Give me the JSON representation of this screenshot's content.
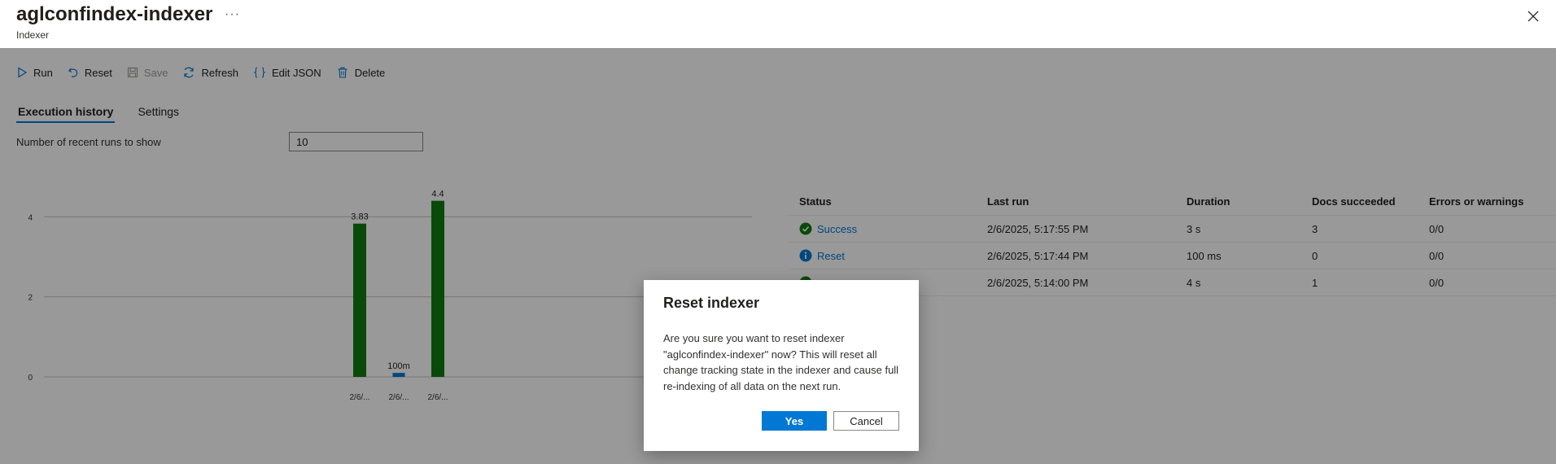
{
  "header": {
    "title": "aglconfindex-indexer",
    "more": "···",
    "subtitle": "Indexer"
  },
  "toolbar": {
    "run": "Run",
    "reset": "Reset",
    "save": "Save",
    "refresh": "Refresh",
    "edit_json": "Edit JSON",
    "delete": "Delete"
  },
  "tabs": {
    "execution_history": "Execution history",
    "settings": "Settings"
  },
  "runs": {
    "label": "Number of recent runs to show",
    "value": "10"
  },
  "chart_data": {
    "type": "bar",
    "categories": [
      "2/6/...",
      "2/6/...",
      "2/6/..."
    ],
    "values": [
      3.83,
      0.1,
      4.4
    ],
    "data_labels": [
      "3.83",
      "100m",
      "4.4"
    ],
    "ylim": [
      0,
      6
    ],
    "yticks": [
      "0",
      "2",
      "4",
      "6"
    ],
    "grid": true,
    "bar_colors": [
      "#107c10",
      "#0078d4",
      "#107c10"
    ]
  },
  "table": {
    "headers": [
      "Status",
      "Last run",
      "Duration",
      "Docs succeeded",
      "Errors or warnings"
    ],
    "rows": [
      {
        "status": "Success",
        "last_run": "2/6/2025, 5:17:55 PM",
        "duration": "3 s",
        "docs": "3",
        "errors": "0/0"
      },
      {
        "status": "Reset",
        "last_run": "2/6/2025, 5:17:44 PM",
        "duration": "100 ms",
        "docs": "0",
        "errors": "0/0"
      },
      {
        "status": "",
        "last_run": "2/6/2025, 5:14:00 PM",
        "duration": "4 s",
        "docs": "1",
        "errors": "0/0"
      }
    ]
  },
  "dialog": {
    "title": "Reset indexer",
    "message": "Are you sure you want to reset indexer \"aglconfindex-indexer\" now? This will reset all change tracking state in the indexer and cause full re-indexing of all data on the next run.",
    "yes": "Yes",
    "cancel": "Cancel"
  },
  "colors": {
    "accent": "#0078d4",
    "success": "#107c10",
    "overlay": "rgba(0,0,0,0.4)"
  }
}
